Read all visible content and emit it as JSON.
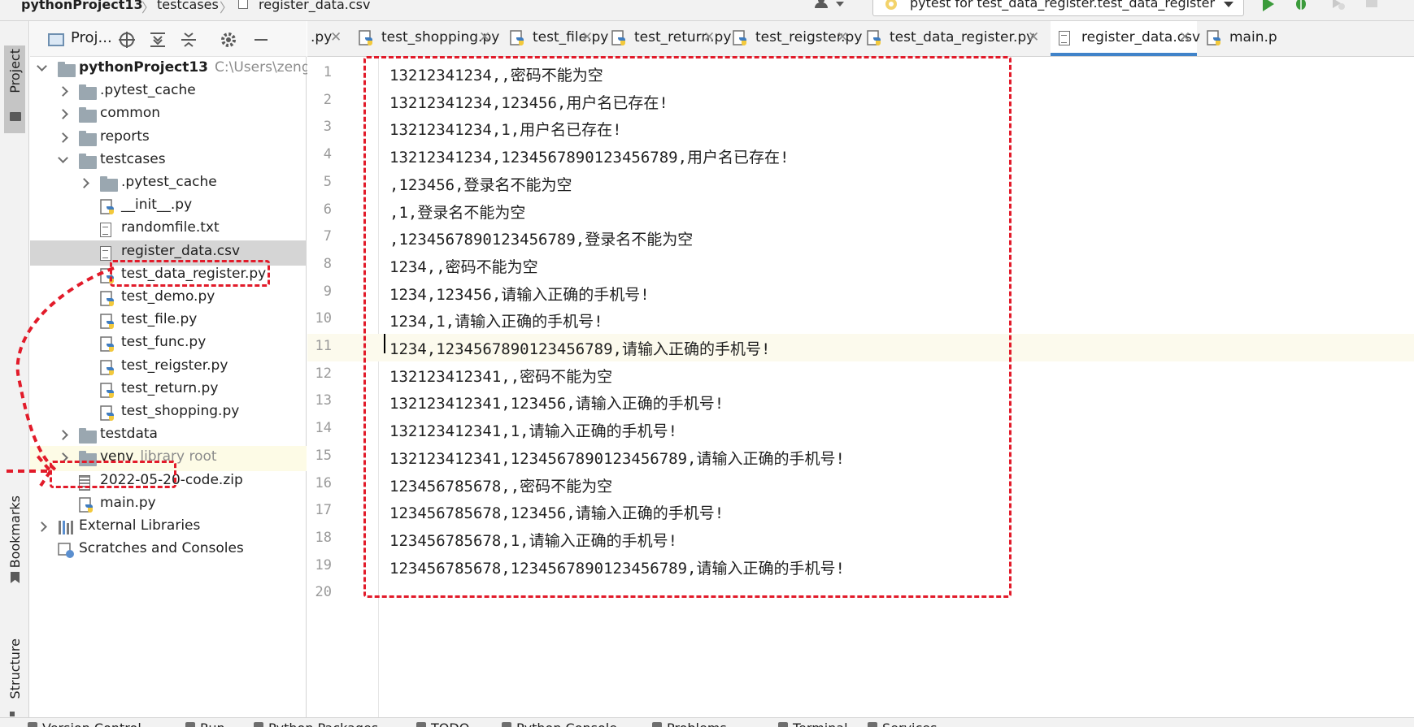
{
  "navbar": {
    "project": "pythonProject13",
    "folder": "testcases",
    "file": "register_data.csv",
    "run_config": "pytest for test_data_register.test_data_register"
  },
  "tool_stripe": {
    "project": "Project",
    "bookmarks": "Bookmarks",
    "structure": "Structure"
  },
  "project_panel": {
    "title": "Proj...",
    "tree": [
      {
        "label": "pythonProject13",
        "note": "C:\\Users\\zengy",
        "icon": "folder-icon",
        "arrow": "open",
        "level": 0
      },
      {
        "label": ".pytest_cache",
        "icon": "folder-icon",
        "arrow": "closed",
        "level": 1
      },
      {
        "label": "common",
        "icon": "folder-icon",
        "arrow": "closed",
        "level": 1
      },
      {
        "label": "reports",
        "icon": "folder-icon",
        "arrow": "closed",
        "level": 1
      },
      {
        "label": "testcases",
        "icon": "folder-icon",
        "arrow": "open",
        "level": 1
      },
      {
        "label": ".pytest_cache",
        "icon": "folder-icon",
        "arrow": "closed",
        "level": 2
      },
      {
        "label": "__init__.py",
        "icon": "python-file-icon",
        "level": 2
      },
      {
        "label": "randomfile.txt",
        "icon": "text-file-icon",
        "level": 2
      },
      {
        "label": "register_data.csv",
        "icon": "text-file-icon",
        "level": 2,
        "selected": true
      },
      {
        "label": "test_data_register.py",
        "icon": "python-file-icon",
        "level": 2
      },
      {
        "label": "test_demo.py",
        "icon": "python-file-icon",
        "level": 2
      },
      {
        "label": "test_file.py",
        "icon": "python-file-icon",
        "level": 2
      },
      {
        "label": "test_func.py",
        "icon": "python-file-icon",
        "level": 2
      },
      {
        "label": "test_reigster.py",
        "icon": "python-file-icon",
        "level": 2
      },
      {
        "label": "test_return.py",
        "icon": "python-file-icon",
        "level": 2
      },
      {
        "label": "test_shopping.py",
        "icon": "python-file-icon",
        "level": 2
      },
      {
        "label": "testdata",
        "icon": "folder-icon",
        "arrow": "closed",
        "level": 1
      },
      {
        "label": "venv",
        "note": "library root",
        "icon": "folder-icon",
        "arrow": "closed",
        "level": 1,
        "library": true
      },
      {
        "label": "2022-05-20-code.zip",
        "icon": "zip-file-icon",
        "level": 1
      },
      {
        "label": "main.py",
        "icon": "python-file-icon",
        "level": 1
      },
      {
        "label": "External Libraries",
        "icon": "library-icon",
        "arrow": "closed",
        "level": 0
      },
      {
        "label": "Scratches and Consoles",
        "icon": "scratch-icon",
        "level": 0
      }
    ]
  },
  "editor": {
    "tabs": [
      {
        "label": ".py",
        "icon": "",
        "active": false
      },
      {
        "label": "test_shopping.py",
        "icon": "python-file-icon",
        "active": false
      },
      {
        "label": "test_file.py",
        "icon": "python-file-icon",
        "active": false
      },
      {
        "label": "test_return.py",
        "icon": "python-file-icon",
        "active": false
      },
      {
        "label": "test_reigster.py",
        "icon": "python-file-icon",
        "active": false
      },
      {
        "label": "test_data_register.py",
        "icon": "python-file-icon",
        "active": false
      },
      {
        "label": "register_data.csv",
        "icon": "text-file-icon",
        "active": true
      },
      {
        "label": "main.p",
        "icon": "python-file-icon",
        "active": false
      }
    ],
    "current_line": 11,
    "lines": [
      {
        "n": "1",
        "text": "13212341234,,密码不能为空"
      },
      {
        "n": "2",
        "text": "13212341234,123456,用户名已存在!"
      },
      {
        "n": "3",
        "text": "13212341234,1,用户名已存在!"
      },
      {
        "n": "4",
        "text": "13212341234,1234567890123456789,用户名已存在!"
      },
      {
        "n": "5",
        "text": ",123456,登录名不能为空"
      },
      {
        "n": "6",
        "text": ",1,登录名不能为空"
      },
      {
        "n": "7",
        "text": ",1234567890123456789,登录名不能为空"
      },
      {
        "n": "8",
        "text": "1234,,密码不能为空"
      },
      {
        "n": "9",
        "text": "1234,123456,请输入正确的手机号!"
      },
      {
        "n": "10",
        "text": "1234,1,请输入正确的手机号!"
      },
      {
        "n": "11",
        "text": "1234,1234567890123456789,请输入正确的手机号!"
      },
      {
        "n": "12",
        "text": "132123412341,,密码不能为空"
      },
      {
        "n": "13",
        "text": "132123412341,123456,请输入正确的手机号!"
      },
      {
        "n": "14",
        "text": "132123412341,1,请输入正确的手机号!"
      },
      {
        "n": "15",
        "text": "132123412341,1234567890123456789,请输入正确的手机号!"
      },
      {
        "n": "16",
        "text": "123456785678,,密码不能为空"
      },
      {
        "n": "17",
        "text": "123456785678,123456,请输入正确的手机号!"
      },
      {
        "n": "18",
        "text": "123456785678,1,请输入正确的手机号!"
      },
      {
        "n": "19",
        "text": "123456785678,1234567890123456789,请输入正确的手机号!"
      },
      {
        "n": "20",
        "text": ""
      }
    ]
  },
  "bottom_strip": [
    "Version Control",
    "Run",
    "Python Packages",
    "TODO",
    "Python Console",
    "Problems",
    "Terminal",
    "Services"
  ],
  "colors": {
    "annotation_red": "#e21b2a",
    "active_tab_underline": "#4083c9",
    "selected_row": "#d5d5d5",
    "current_line": "#fcfaed",
    "run_green": "#3b9b3b",
    "folder_grey": "#9aa7b0"
  }
}
